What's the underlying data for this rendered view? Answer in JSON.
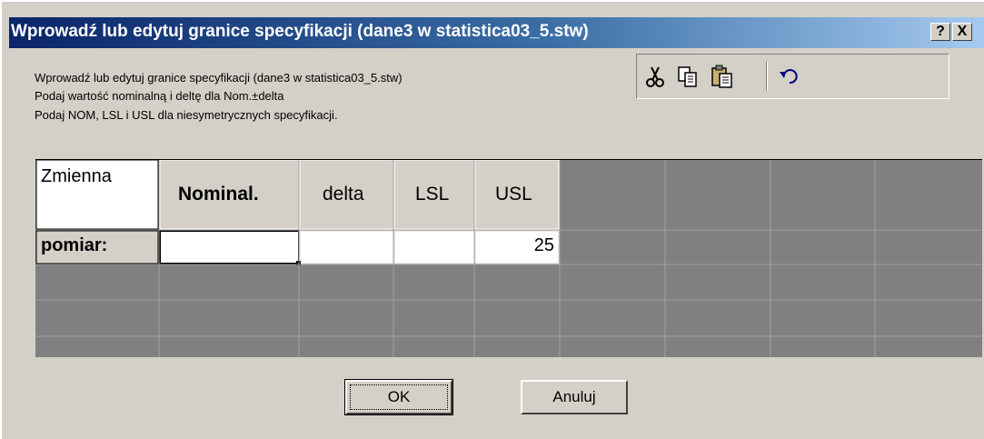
{
  "window": {
    "title": "Wprowadź lub edytuj granice specyfikacji (dane3 w statistica03_5.stw)",
    "help_label": "?",
    "close_label": "X"
  },
  "description": {
    "line1": "Wprowadź lub edytuj granice specyfikacji (dane3 w statistica03_5.stw)",
    "line2": "Podaj wartość nominalną i deltę dla Nom.±delta",
    "line3": "Podaj NOM, LSL i USL dla niesymetrycznych specyfikacji."
  },
  "toolbar": {
    "cut_icon": "scissors-icon",
    "copy_icon": "copy-icon",
    "paste_icon": "paste-icon",
    "undo_icon": "undo-icon"
  },
  "grid": {
    "corner_label": "Zmienna",
    "headers": [
      "Nominal.",
      "delta",
      "LSL",
      "USL"
    ],
    "row_label": "pomiar:",
    "values": [
      "",
      "",
      "",
      "25"
    ]
  },
  "buttons": {
    "ok_label": "OK",
    "cancel_label": "Anuluj"
  },
  "colors": {
    "titlebar_start": "#0a246a",
    "titlebar_end": "#a6caf0",
    "dialog_bg": "#d4d0c8",
    "grid_bg": "#808080"
  }
}
